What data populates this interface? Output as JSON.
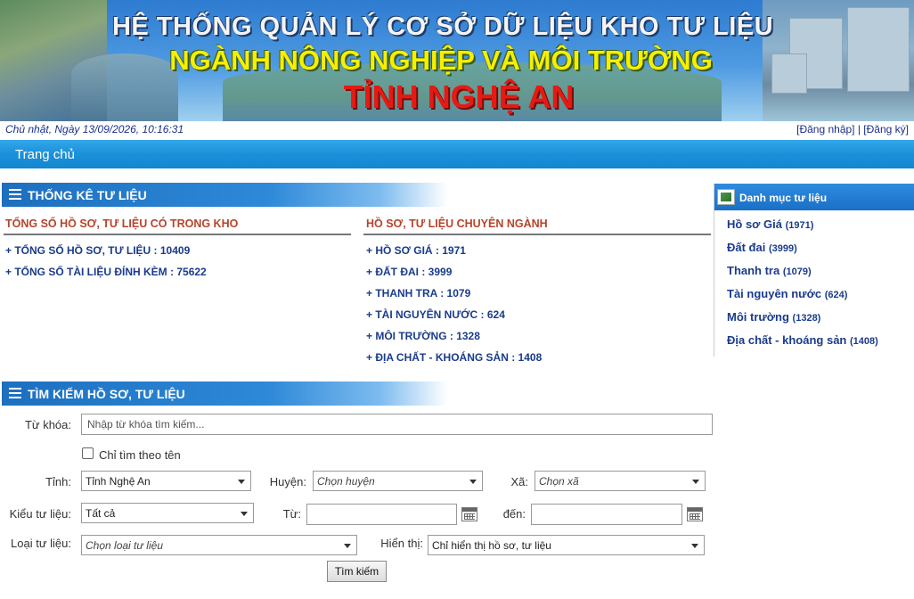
{
  "banner": {
    "line1": "HỆ THỐNG QUẢN LÝ CƠ SỞ DỮ LIỆU KHO TƯ LIỆU",
    "line2": "NGÀNH NÔNG NGHIỆP VÀ MÔI TRƯỜNG",
    "line3": "TỈNH NGHỆ AN"
  },
  "datebar": {
    "date": "Chủ nhật, Ngày 13/09/2026, 10:16:31",
    "login": "[Đăng nhập]",
    "separator": " | ",
    "register": "[Đăng ký]"
  },
  "nav": {
    "home": "Trang chủ"
  },
  "stats": {
    "title": "THỐNG KÊ TƯ LIỆU",
    "left_title": "TỔNG SỐ HỒ SƠ, TƯ LIỆU CÓ TRONG KHO",
    "left_items": [
      "+ TỔNG SỐ HỒ SƠ, TƯ LIỆU : 10409",
      "+ TỔNG SỐ TÀI LIỆU ĐÍNH KÈM : 75622"
    ],
    "right_title": "HỒ SƠ, TƯ LIỆU CHUYÊN NGÀNH",
    "right_items": [
      "+ HỒ SƠ GIÁ : 1971",
      "+ ĐẤT ĐAI : 3999",
      "+ THANH TRA : 1079",
      "+ TÀI NGUYÊN NƯỚC : 624",
      "+ MÔI TRƯỜNG : 1328",
      "+ ĐỊA CHẤT - KHOÁNG SẢN : 1408"
    ]
  },
  "panel": {
    "title": "Danh mục tư liệu",
    "items": [
      {
        "label": "Hồ sơ Giá",
        "count": "(1971)"
      },
      {
        "label": "Đất đai",
        "count": "(3999)"
      },
      {
        "label": "Thanh tra",
        "count": "(1079)"
      },
      {
        "label": "Tài nguyên nước",
        "count": "(624)"
      },
      {
        "label": "Môi trường",
        "count": "(1328)"
      },
      {
        "label": "Địa chất - khoáng sản",
        "count": "(1408)"
      }
    ]
  },
  "search": {
    "title": "TÌM KIẾM HỒ SƠ, TƯ LIỆU",
    "keyword_label": "Từ khóa:",
    "keyword_placeholder": "Nhập từ khóa tìm kiếm...",
    "name_only_label": "Chỉ tìm theo tên",
    "province_label": "Tỉnh:",
    "province_value": "Tỉnh Nghệ An",
    "district_label": "Huyện:",
    "district_value": "Chọn huyện",
    "commune_label": "Xã:",
    "commune_value": "Chọn xã",
    "type_label": "Kiểu tư liệu:",
    "type_value": "Tất cả",
    "from_label": "Từ:",
    "to_label": "đến:",
    "kind_label": "Loại tư liệu:",
    "kind_value": "Chọn loại tư liệu",
    "display_label": "Hiển thị:",
    "display_value": "Chỉ hiển thị hồ sơ, tư liệu",
    "submit": "Tìm kiếm"
  }
}
